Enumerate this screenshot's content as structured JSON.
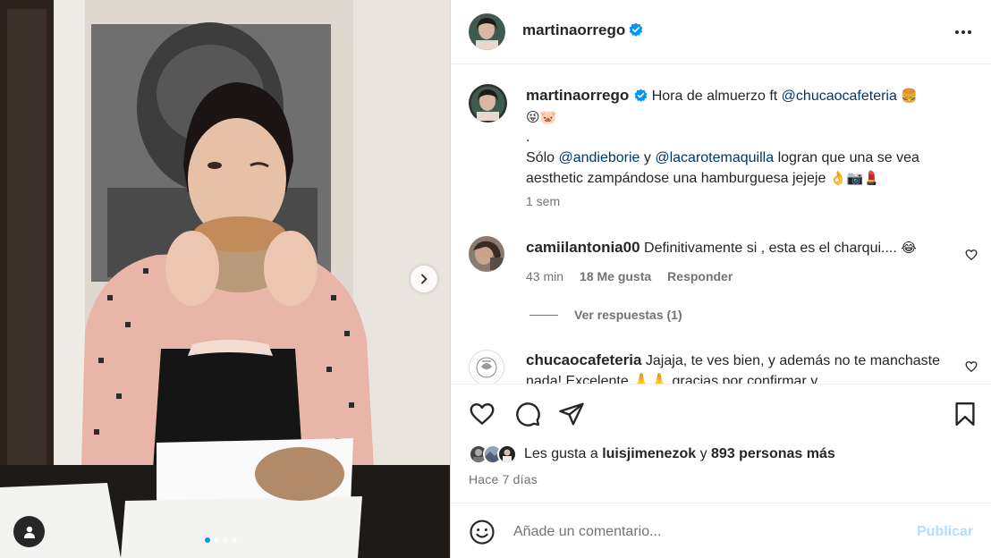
{
  "post": {
    "username": "martinaorrego",
    "verified": true,
    "photo": {
      "carousel_index": 1,
      "carousel_count": 4
    }
  },
  "caption": {
    "username": "martinaorrego",
    "text_1": "Hora de almuerzo ft",
    "mention_1": "@chucaocafeteria",
    "emojis_1": "🍔",
    "emojis_2": "😜🐷",
    "separator": ".",
    "text_2": "Sólo",
    "mention_2": "@andieborie",
    "text_3": "y",
    "mention_3": "@lacarotemaquilla",
    "text_4": "logran que una se vea aesthetic zampándose una hamburguesa jejeje",
    "emojis_3": "👌📷💄",
    "time": "1 sem"
  },
  "comments": [
    {
      "username": "camiilantonia00",
      "text": "Definitivamente si , esta es el charqui....",
      "emoji": "😂",
      "time": "43 min",
      "likes": "18 Me gusta",
      "reply_label": "Responder",
      "view_replies": "Ver respuestas (1)"
    },
    {
      "username": "chucaocafeteria",
      "text": "Jajaja, te ves bien, y además no te manchaste nada! Excelente 🙏🙏 gracias por confirmar y..."
    }
  ],
  "likes": {
    "prefix": "Les gusta a",
    "user": "luisjimenezok",
    "connector": "y",
    "others": "893 personas más"
  },
  "date": "Hace 7 días",
  "add_comment": {
    "placeholder": "Añade un comentario...",
    "publish_label": "Publicar"
  },
  "colors": {
    "verified": "#0095f6",
    "mention": "#00376b",
    "publish_disabled": "#b2dffc",
    "secondary_text": "#737373"
  },
  "icons": [
    "verified-badge-icon",
    "more-options-icon",
    "heart-icon",
    "comment-icon",
    "share-icon",
    "save-icon",
    "emoji-icon",
    "chevron-right-icon",
    "user-tag-icon"
  ]
}
